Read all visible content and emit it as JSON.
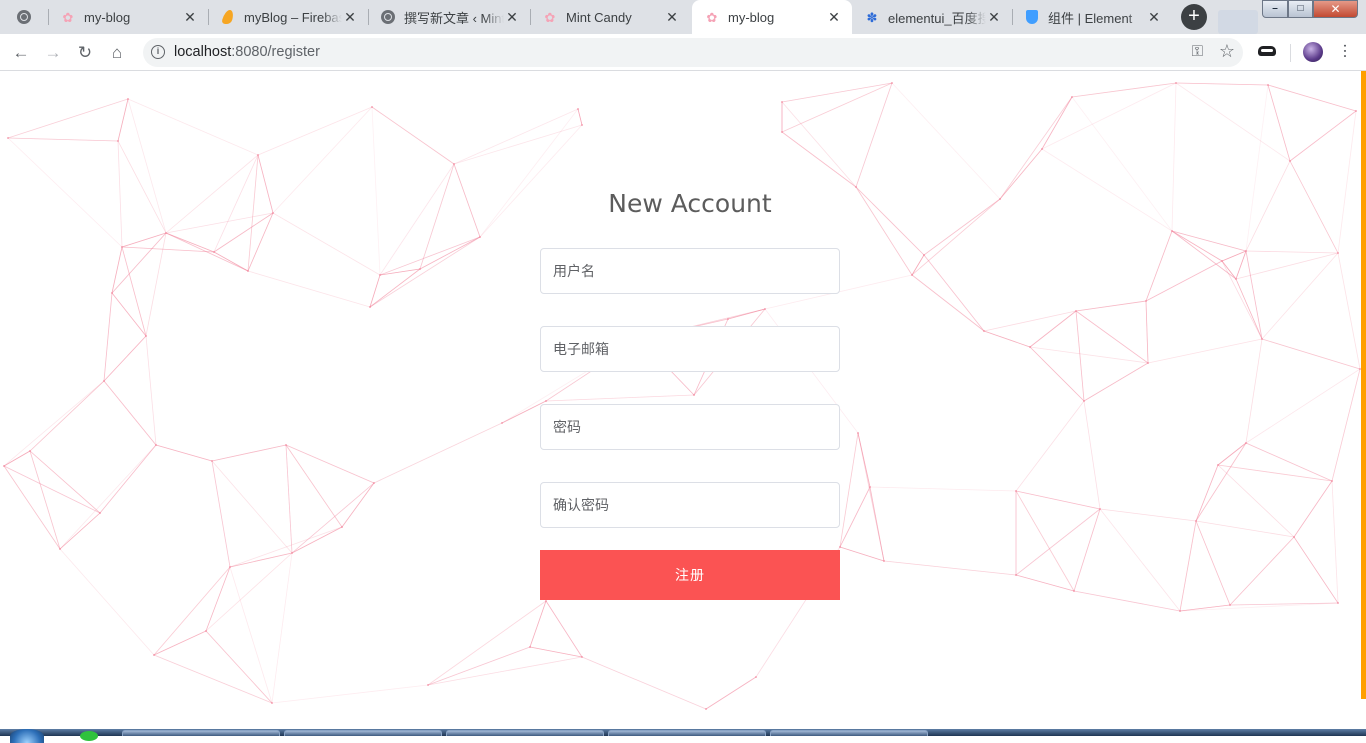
{
  "browser": {
    "tabs": [
      {
        "title": "",
        "icon": "globe-icon",
        "active": false
      },
      {
        "title": "my-blog",
        "icon": "cherry-blossom-icon",
        "active": false
      },
      {
        "title": "myBlog – Firebase",
        "icon": "firebase-icon",
        "active": false
      },
      {
        "title": "撰写新文章 ‹ Mint Candy",
        "icon": "globe-icon",
        "active": false
      },
      {
        "title": "Mint Candy",
        "icon": "cherry-blossom-icon",
        "active": false
      },
      {
        "title": "my-blog",
        "icon": "cherry-blossom-icon",
        "active": true
      },
      {
        "title": "elementui_百度搜索",
        "icon": "baidu-paw-icon",
        "active": false
      },
      {
        "title": "组件 | Element",
        "icon": "element-shield-icon",
        "active": false
      }
    ],
    "new_tab_label": "+",
    "close_glyph": "✕",
    "window_controls": {
      "minimize": "–",
      "maximize": "□",
      "close": "✕"
    },
    "address": {
      "host": "localhost",
      "path": ":8080/register"
    }
  },
  "form": {
    "title": "New Account",
    "username_placeholder": "用户名",
    "email_placeholder": "电子邮箱",
    "password_placeholder": "密码",
    "confirm_placeholder": "确认密码",
    "submit_label": "注册"
  },
  "colors": {
    "accent_button": "#fb5353",
    "network_lines": "#f28aa0",
    "scroll_indicator": "#ff9f00"
  }
}
